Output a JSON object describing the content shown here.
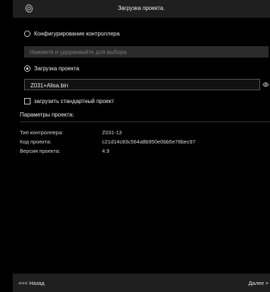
{
  "header": {
    "title": "Загрузка проекта.",
    "icon": "gear-icon"
  },
  "options": {
    "configure_label": "Конфигурирование контроллера",
    "configure_hint": "Нажмите и удерживайте для выбора",
    "load_label": "Загрузка проекта",
    "file_value": "Z031+Alisa.bin",
    "standard_label": "загрузить стандартный проект"
  },
  "params": {
    "heading": "Параметры проекта:",
    "rows": [
      {
        "key": "Тип контроллера:",
        "value": "Z031-13"
      },
      {
        "key": "Код проекта:",
        "value": "c21d14c83c564a8b950e0bb5e78bec97"
      },
      {
        "key": "Версия проекта:",
        "value": "4.9"
      }
    ]
  },
  "footer": {
    "back_label": "<<< Назад",
    "next_label": "Далее >"
  }
}
